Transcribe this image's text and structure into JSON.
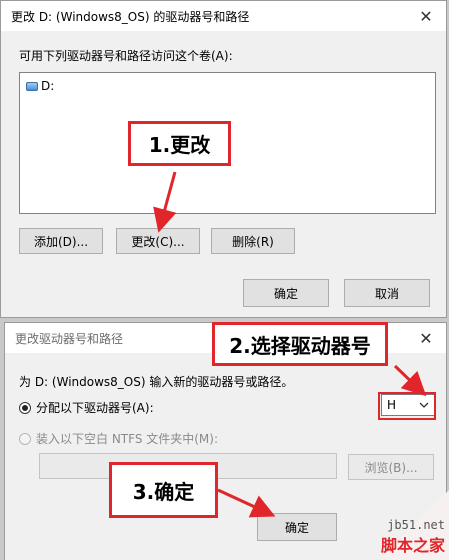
{
  "dialog1": {
    "title": "更改 D: (Windows8_OS) 的驱动器号和路径",
    "volume_label": "可用下列驱动器号和路径访问这个卷(A):",
    "list_item": "D:",
    "buttons": {
      "add": "添加(D)...",
      "change": "更改(C)...",
      "remove": "删除(R)",
      "ok": "确定",
      "cancel": "取消"
    },
    "close_glyph": "✕"
  },
  "dialog2": {
    "title": "更改驱动器号和路径",
    "description": "为 D: (Windows8_OS) 输入新的驱动器号或路径。",
    "option_assign": "分配以下驱动器号(A):",
    "option_mount": "装入以下空白 NTFS 文件夹中(M):",
    "drive_letter": "H",
    "browse": "浏览(B)...",
    "ok": "确定",
    "close_glyph": "✕"
  },
  "annotations": {
    "step1": "1.更改",
    "step2": "2.选择驱动器号",
    "step3": "3.确定"
  },
  "watermark": {
    "url": "jb51.net",
    "name": "脚本之家"
  },
  "colors": {
    "annotation_red": "#e0262b",
    "dialog_bg": "#f0f0f0"
  }
}
